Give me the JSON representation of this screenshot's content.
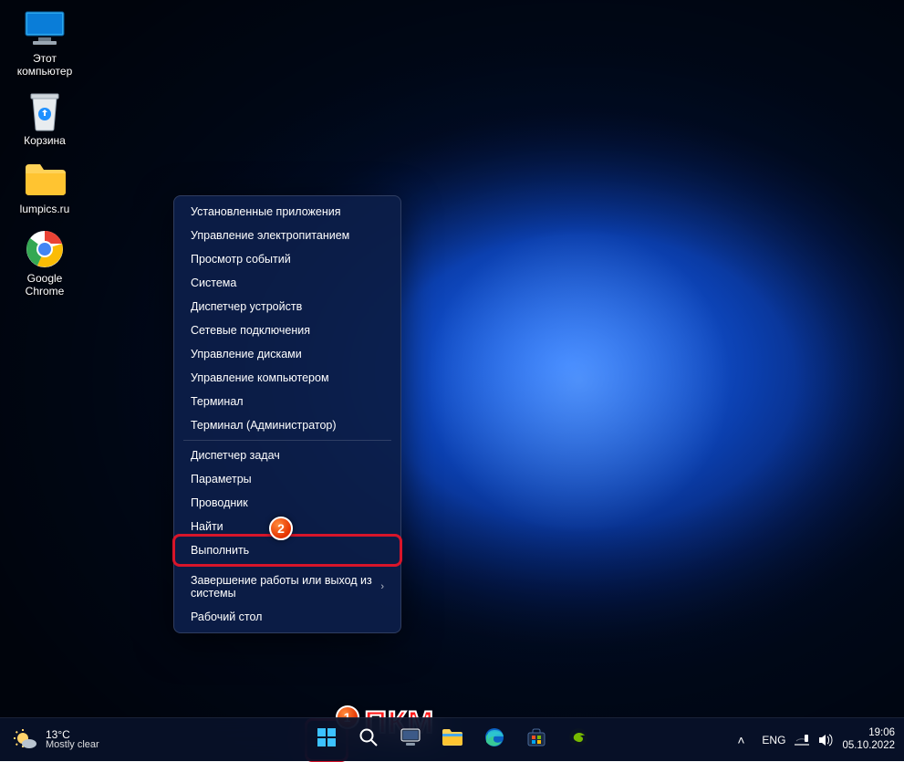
{
  "desktop": {
    "icons": [
      {
        "label": "Этот компьютер",
        "kind": "pc"
      },
      {
        "label": "Корзина",
        "kind": "trash"
      },
      {
        "label": "lumpics.ru",
        "kind": "folder"
      },
      {
        "label": "Google Chrome",
        "kind": "chrome"
      }
    ]
  },
  "context_menu": {
    "groups": [
      [
        "Установленные приложения",
        "Управление электропитанием",
        "Просмотр событий",
        "Система",
        "Диспетчер устройств",
        "Сетевые подключения",
        "Управление дисками",
        "Управление компьютером",
        "Терминал",
        "Терминал (Администратор)"
      ],
      [
        "Диспетчер задач",
        "Параметры",
        "Проводник",
        "Найти",
        "Выполнить"
      ],
      [
        {
          "label": "Завершение работы или выход из системы",
          "submenu": true
        },
        "Рабочий стол"
      ]
    ],
    "highlighted_index": [
      1,
      4
    ]
  },
  "annotations": {
    "callout1": "1",
    "callout2": "2",
    "pkm": "ПКМ"
  },
  "taskbar": {
    "weather": {
      "temp": "13°C",
      "desc": "Mostly clear"
    },
    "center_icons": [
      "start",
      "search",
      "taskview",
      "explorer",
      "edge",
      "store",
      "geforce"
    ],
    "tray": {
      "chevron": "˄",
      "lang": "ENG",
      "time": "19:06",
      "date": "05.10.2022"
    }
  }
}
